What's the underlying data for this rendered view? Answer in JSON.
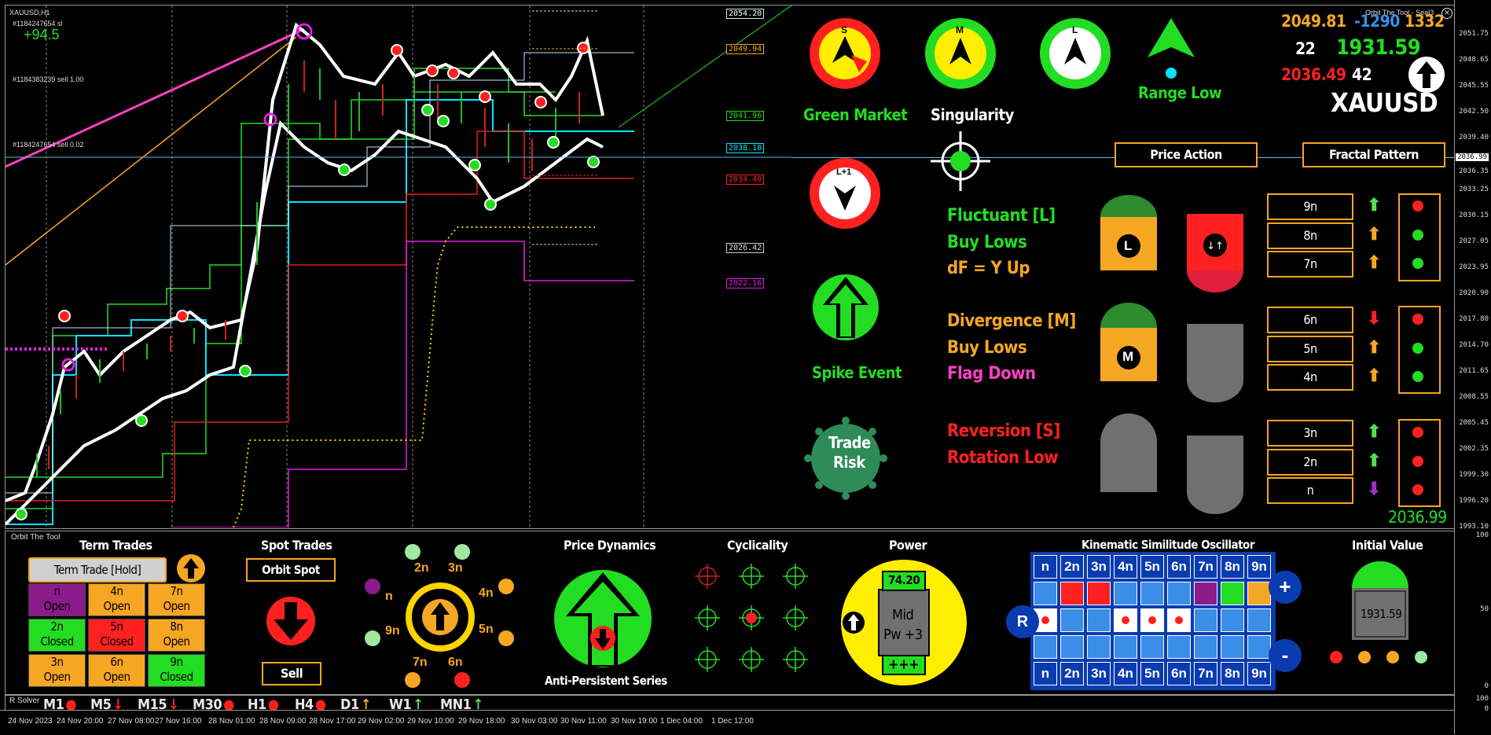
{
  "chart": {
    "symbol_label": "XAUUSD,H1",
    "order_1": "#1184247654 sl",
    "profit": "+94.5",
    "order_2": "#1184383239 sell 1.00",
    "order_3": "#1184247654 sell 0.02",
    "price_tags": [
      "2054.20",
      "2049.94",
      "2041.96",
      "2038.18",
      "2034.40",
      "2026.42",
      "2022.16"
    ],
    "current_price_tag": "2036.99"
  },
  "price_axis": [
    "2051.75",
    "2048.65",
    "2045.55",
    "2042.50",
    "2039.40",
    "2036.35",
    "2033.25",
    "2030.15",
    "2027.05",
    "2023.95",
    "2020.90",
    "2017.80",
    "2014.70",
    "2011.65",
    "2008.55",
    "2005.45",
    "2002.35",
    "1999.30",
    "1996.20",
    "1993.10"
  ],
  "sub_axis": [
    "100",
    "50",
    "0",
    "100",
    "0"
  ],
  "time_axis": [
    "24 Nov 2023",
    "24 Nov 20:00",
    "27 Nov 08:00",
    "27 Nov 16:00",
    "28 Nov 01:00",
    "28 Nov 09:00",
    "28 Nov 17:00",
    "29 Nov 02:00",
    "29 Nov 10:00",
    "29 Nov 18:00",
    "30 Nov 03:00",
    "30 Nov 11:00",
    "30 Nov 19:00",
    "1 Dec 04:00",
    "1 Dec 12:00"
  ],
  "header": {
    "brand": "Orbit The Tool - Seal3",
    "val_a": "2049.81",
    "val_b": "-1290",
    "val_c": "1332",
    "val_d": "22",
    "val_e": "1931.59",
    "val_f": "2036.49",
    "val_g": "42",
    "symbol": "XAUUSD"
  },
  "signals": {
    "s_letter": "S",
    "m_letter": "M",
    "l_letter": "L",
    "l1_letter": "L+1",
    "green_market": "Green Market",
    "singularity": "Singularity",
    "range_low": "Range Low",
    "spike_event": "Spike Event",
    "trade_risk_1": "Trade",
    "trade_risk_2": "Risk",
    "price_action": "Price Action",
    "fractal_pattern": "Fractal Pattern"
  },
  "states": [
    {
      "title": "Fluctuant [L]",
      "line2": "Buy Lows",
      "line3": "dF = Y Up",
      "badge": "L"
    },
    {
      "title": "Divergence [M]",
      "line2": "Buy Lows",
      "line3": "Flag Down",
      "badge": "M"
    },
    {
      "title": "Reversion [S]",
      "line2": "Rotation Low",
      "line3": "",
      "badge": ""
    }
  ],
  "fractal_rows": [
    {
      "label": "9n",
      "arrow": "up",
      "arrow_color": "#55dd55",
      "dot": "#ff2020"
    },
    {
      "label": "8n",
      "arrow": "up",
      "arrow_color": "#f5a623",
      "dot": "#22dd22"
    },
    {
      "label": "7n",
      "arrow": "up",
      "arrow_color": "#f5a623",
      "dot": "#22dd22"
    },
    {
      "label": "6n",
      "arrow": "down",
      "arrow_color": "#ff2020",
      "dot": "#ff2020"
    },
    {
      "label": "5n",
      "arrow": "up",
      "arrow_color": "#f5a623",
      "dot": "#22dd22"
    },
    {
      "label": "4n",
      "arrow": "up",
      "arrow_color": "#f5a623",
      "dot": "#22dd22"
    },
    {
      "label": "3n",
      "arrow": "up",
      "arrow_color": "#55dd55",
      "dot": "#ff2020"
    },
    {
      "label": "2n",
      "arrow": "up",
      "arrow_color": "#55dd55",
      "dot": "#ff2020"
    },
    {
      "label": "n",
      "arrow": "down",
      "arrow_color": "#9b30c8",
      "dot": "#ff2020"
    }
  ],
  "last_price": "2036.99",
  "bottom": {
    "panel_name": "Orbit The Tool",
    "term_trades": "Term Trades",
    "term_trade_hold": "Term Trade [Hold]",
    "term_cells": [
      {
        "l1": "n",
        "l2": "Open",
        "bg": "#8b1a8b"
      },
      {
        "l1": "4n",
        "l2": "Open",
        "bg": "#f5a623"
      },
      {
        "l1": "7n",
        "l2": "Open",
        "bg": "#f5a623"
      },
      {
        "l1": "2n",
        "l2": "Closed",
        "bg": "#22dd22"
      },
      {
        "l1": "5n",
        "l2": "Closed",
        "bg": "#ff2020"
      },
      {
        "l1": "8n",
        "l2": "Open",
        "bg": "#f5a623"
      },
      {
        "l1": "3n",
        "l2": "Open",
        "bg": "#f5a623"
      },
      {
        "l1": "6n",
        "l2": "Open",
        "bg": "#f5a623"
      },
      {
        "l1": "9n",
        "l2": "Closed",
        "bg": "#22dd22"
      }
    ],
    "spot_trades": "Spot Trades",
    "orbit_spot": "Orbit Spot",
    "sell": "Sell",
    "orbit_labels": [
      "2n",
      "3n",
      "4n",
      "5n",
      "6n",
      "7n",
      "9n",
      "n"
    ],
    "price_dynamics": "Price Dynamics",
    "anti_persistent": "Anti-Persistent Series",
    "cyclicality": "Cyclicality",
    "power": "Power",
    "power_value": "74.20",
    "power_mid": "Mid",
    "power_pw": "Pw +3",
    "power_plus": "+++",
    "kso_title": "Kinematic Similitude Oscillator",
    "kso_headers": [
      "n",
      "2n",
      "3n",
      "4n",
      "5n",
      "6n",
      "7n",
      "8n",
      "9n"
    ],
    "kso_r": "R",
    "kso_plus": "+",
    "kso_minus": "-",
    "initial_value": "Initial Value",
    "initial_value_num": "1931.59",
    "solver": "R Solver",
    "timeframes": [
      {
        "label": "M1",
        "mark": "dot",
        "color": "#ff2020"
      },
      {
        "label": "M5",
        "mark": "down",
        "color": "#ff2020"
      },
      {
        "label": "M15",
        "mark": "down",
        "color": "#ff2020"
      },
      {
        "label": "M30",
        "mark": "dot",
        "color": "#ff2020"
      },
      {
        "label": "H1",
        "mark": "dot",
        "color": "#ff2020"
      },
      {
        "label": "H4",
        "mark": "dot",
        "color": "#ff2020"
      },
      {
        "label": "D1",
        "mark": "up",
        "color": "#f5a623"
      },
      {
        "label": "W1",
        "mark": "up",
        "color": "#55dd55"
      },
      {
        "label": "MN1",
        "mark": "up",
        "color": "#55dd55"
      }
    ]
  },
  "colors": {
    "accent": "#f5a623",
    "green": "#22dd22",
    "red": "#ff2020",
    "yellow": "#ffee00",
    "blue": "#3a8ee8"
  }
}
